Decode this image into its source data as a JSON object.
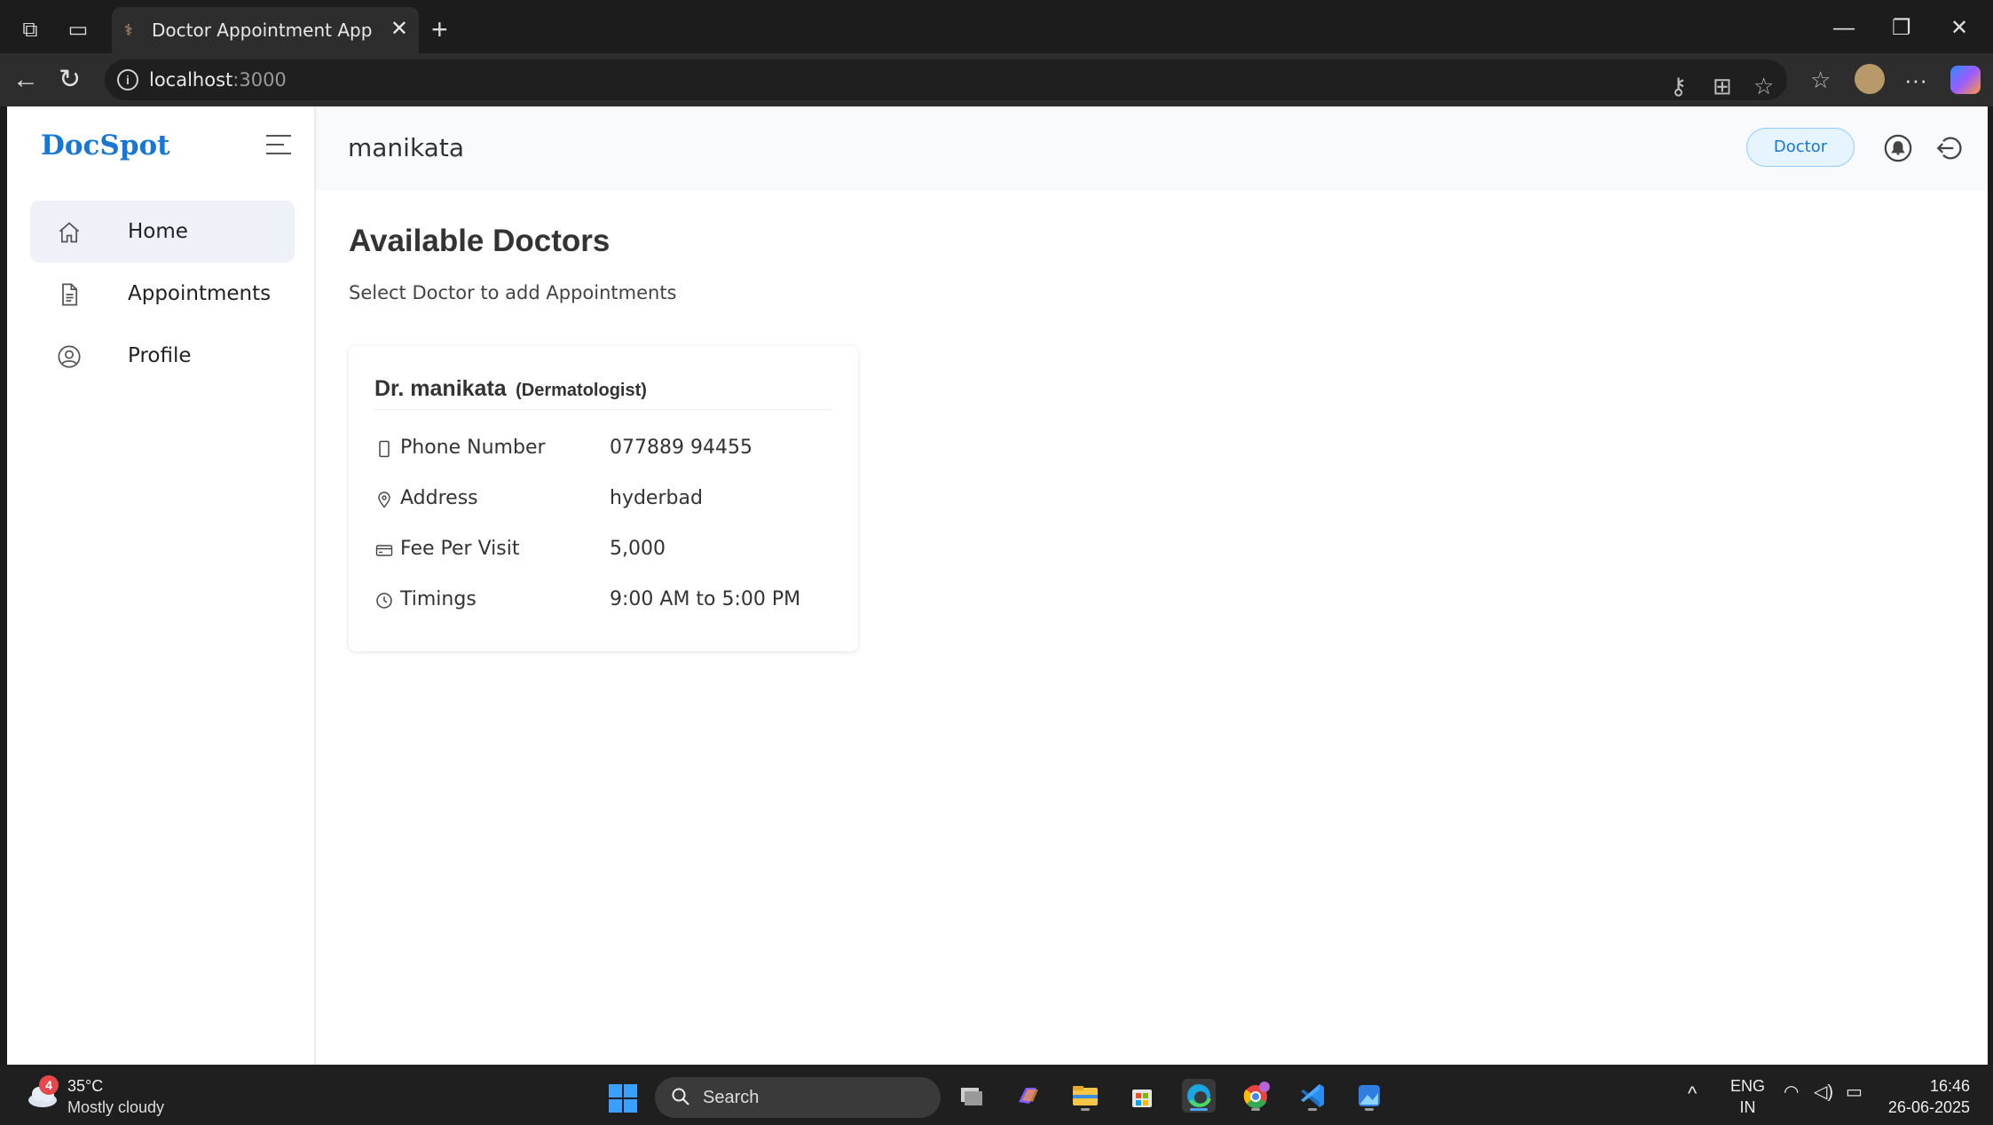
{
  "browser": {
    "tab_title": "Doctor Appointment App",
    "url_host": "localhost",
    "url_port": ":3000"
  },
  "sidebar": {
    "brand": "DocSpot",
    "items": [
      {
        "label": "Home",
        "icon": "home-icon",
        "active": true
      },
      {
        "label": "Appointments",
        "icon": "document-icon",
        "active": false
      },
      {
        "label": "Profile",
        "icon": "user-circle-icon",
        "active": false
      }
    ]
  },
  "header": {
    "username": "manikata",
    "role_badge": "Doctor"
  },
  "main": {
    "title": "Available Doctors",
    "subtitle": "Select Doctor to add Appointments",
    "doctor_card": {
      "name": "Dr. manikata",
      "specialization": "(Dermatologist)",
      "rows": [
        {
          "icon": "phone-icon",
          "label": "Phone Number",
          "value": "077889 94455"
        },
        {
          "icon": "location-icon",
          "label": "Address",
          "value": "hyderbad"
        },
        {
          "icon": "credit-card-icon",
          "label": "Fee Per Visit",
          "value": "5,000"
        },
        {
          "icon": "clock-icon",
          "label": "Timings",
          "value": "9:00 AM to 5:00 PM"
        }
      ]
    }
  },
  "taskbar": {
    "weather_badge": "4",
    "weather_temp": "35°C",
    "weather_desc": "Mostly cloudy",
    "search_label": "Search",
    "lang_top": "ENG",
    "lang_bottom": "IN",
    "time": "16:46",
    "date": "26-06-2025"
  },
  "colors": {
    "brand": "#1677d6",
    "active_menu_bg": "#eef1f8",
    "badge_bg": "#e6f4ff"
  }
}
